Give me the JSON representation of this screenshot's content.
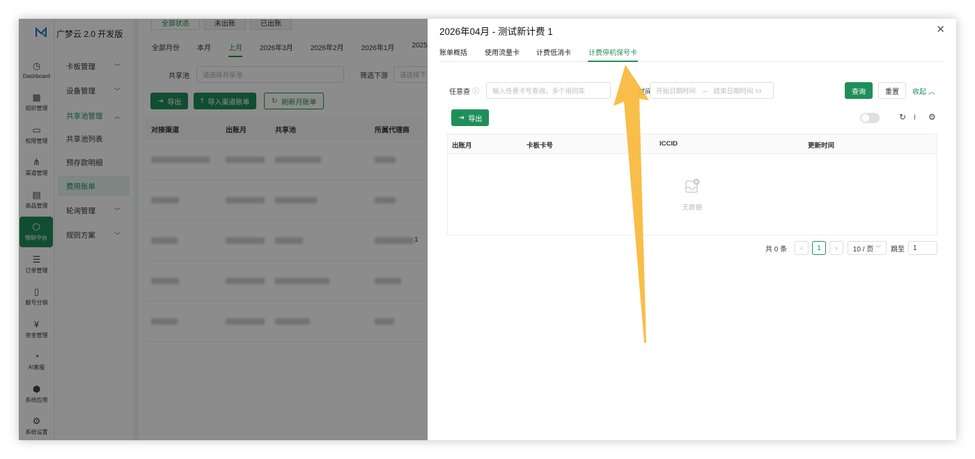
{
  "app": {
    "title": "广梦云 2.0 开发版"
  },
  "rail": [
    {
      "label": "Dashboard",
      "icon": "◷"
    },
    {
      "label": "组织管理",
      "icon": "▦"
    },
    {
      "label": "权限管理",
      "icon": "▭"
    },
    {
      "label": "渠道管理",
      "icon": "⋔"
    },
    {
      "label": "商品管理",
      "icon": "▤"
    },
    {
      "label": "物联中台",
      "icon": "⬡"
    },
    {
      "label": "订单管理",
      "icon": "☰"
    },
    {
      "label": "靓号分销",
      "icon": "▯"
    },
    {
      "label": "资金管理",
      "icon": "¥"
    },
    {
      "label": "AI客服",
      "icon": "◔"
    },
    {
      "label": "系统应用",
      "icon": "⬢"
    },
    {
      "label": "系统设置",
      "icon": "⚙"
    }
  ],
  "submenu": [
    {
      "label": "卡板管理",
      "chevron": "﹀"
    },
    {
      "label": "设备管理",
      "chevron": "﹀"
    },
    {
      "label": "共享池管理",
      "chevron": "︿"
    },
    {
      "label": "共享池列表",
      "chevron": ""
    },
    {
      "label": "预存款明细",
      "chevron": ""
    },
    {
      "label": "费用账单",
      "chevron": ""
    },
    {
      "label": "轮询管理",
      "chevron": "﹀"
    },
    {
      "label": "规则方案",
      "chevron": "﹀"
    }
  ],
  "main": {
    "top_tabs": [
      "全部状态",
      "未出账",
      "已出账"
    ],
    "months": [
      "全部月份",
      "本月",
      "上月",
      "2026年3月",
      "2026年2月",
      "2026年1月",
      "2025"
    ],
    "filter_pool_label": "共享池",
    "filter_pool_placeholder": "请选择共享池",
    "filter_down_label": "筛选下游",
    "filter_down_placeholder": "请选择下",
    "btn_export": "导出",
    "btn_import": "导入渠道账单",
    "btn_refresh": "刷新月账单",
    "columns": [
      "对接渠道",
      "出账月",
      "共享池",
      "所属代理商"
    ],
    "row_suffix": "1"
  },
  "drawer": {
    "title": "2026年04月 - 测试新计费 1",
    "tabs": [
      "账单概括",
      "使用流量卡",
      "计费低消卡",
      "计费停机保号卡"
    ],
    "query_label": "任意查",
    "query_placeholder": "输入任意卡号查询，多个用回车",
    "time_label": "时间",
    "time_start": "开始日期时间",
    "time_end": "结束日期时间",
    "btn_search": "查询",
    "btn_reset": "重置",
    "collapse": "收起",
    "btn_export": "导出",
    "columns": [
      "出账月",
      "卡板卡号",
      "ICCID",
      "更新时间"
    ],
    "empty": "无数据",
    "total": "共 0 条",
    "page": "1",
    "page_size": "10 / 页",
    "jump_label": "跳至",
    "jump_value": "1"
  },
  "colors": {
    "accent": "#1f8f5a",
    "arrow": "#f7b93a"
  }
}
